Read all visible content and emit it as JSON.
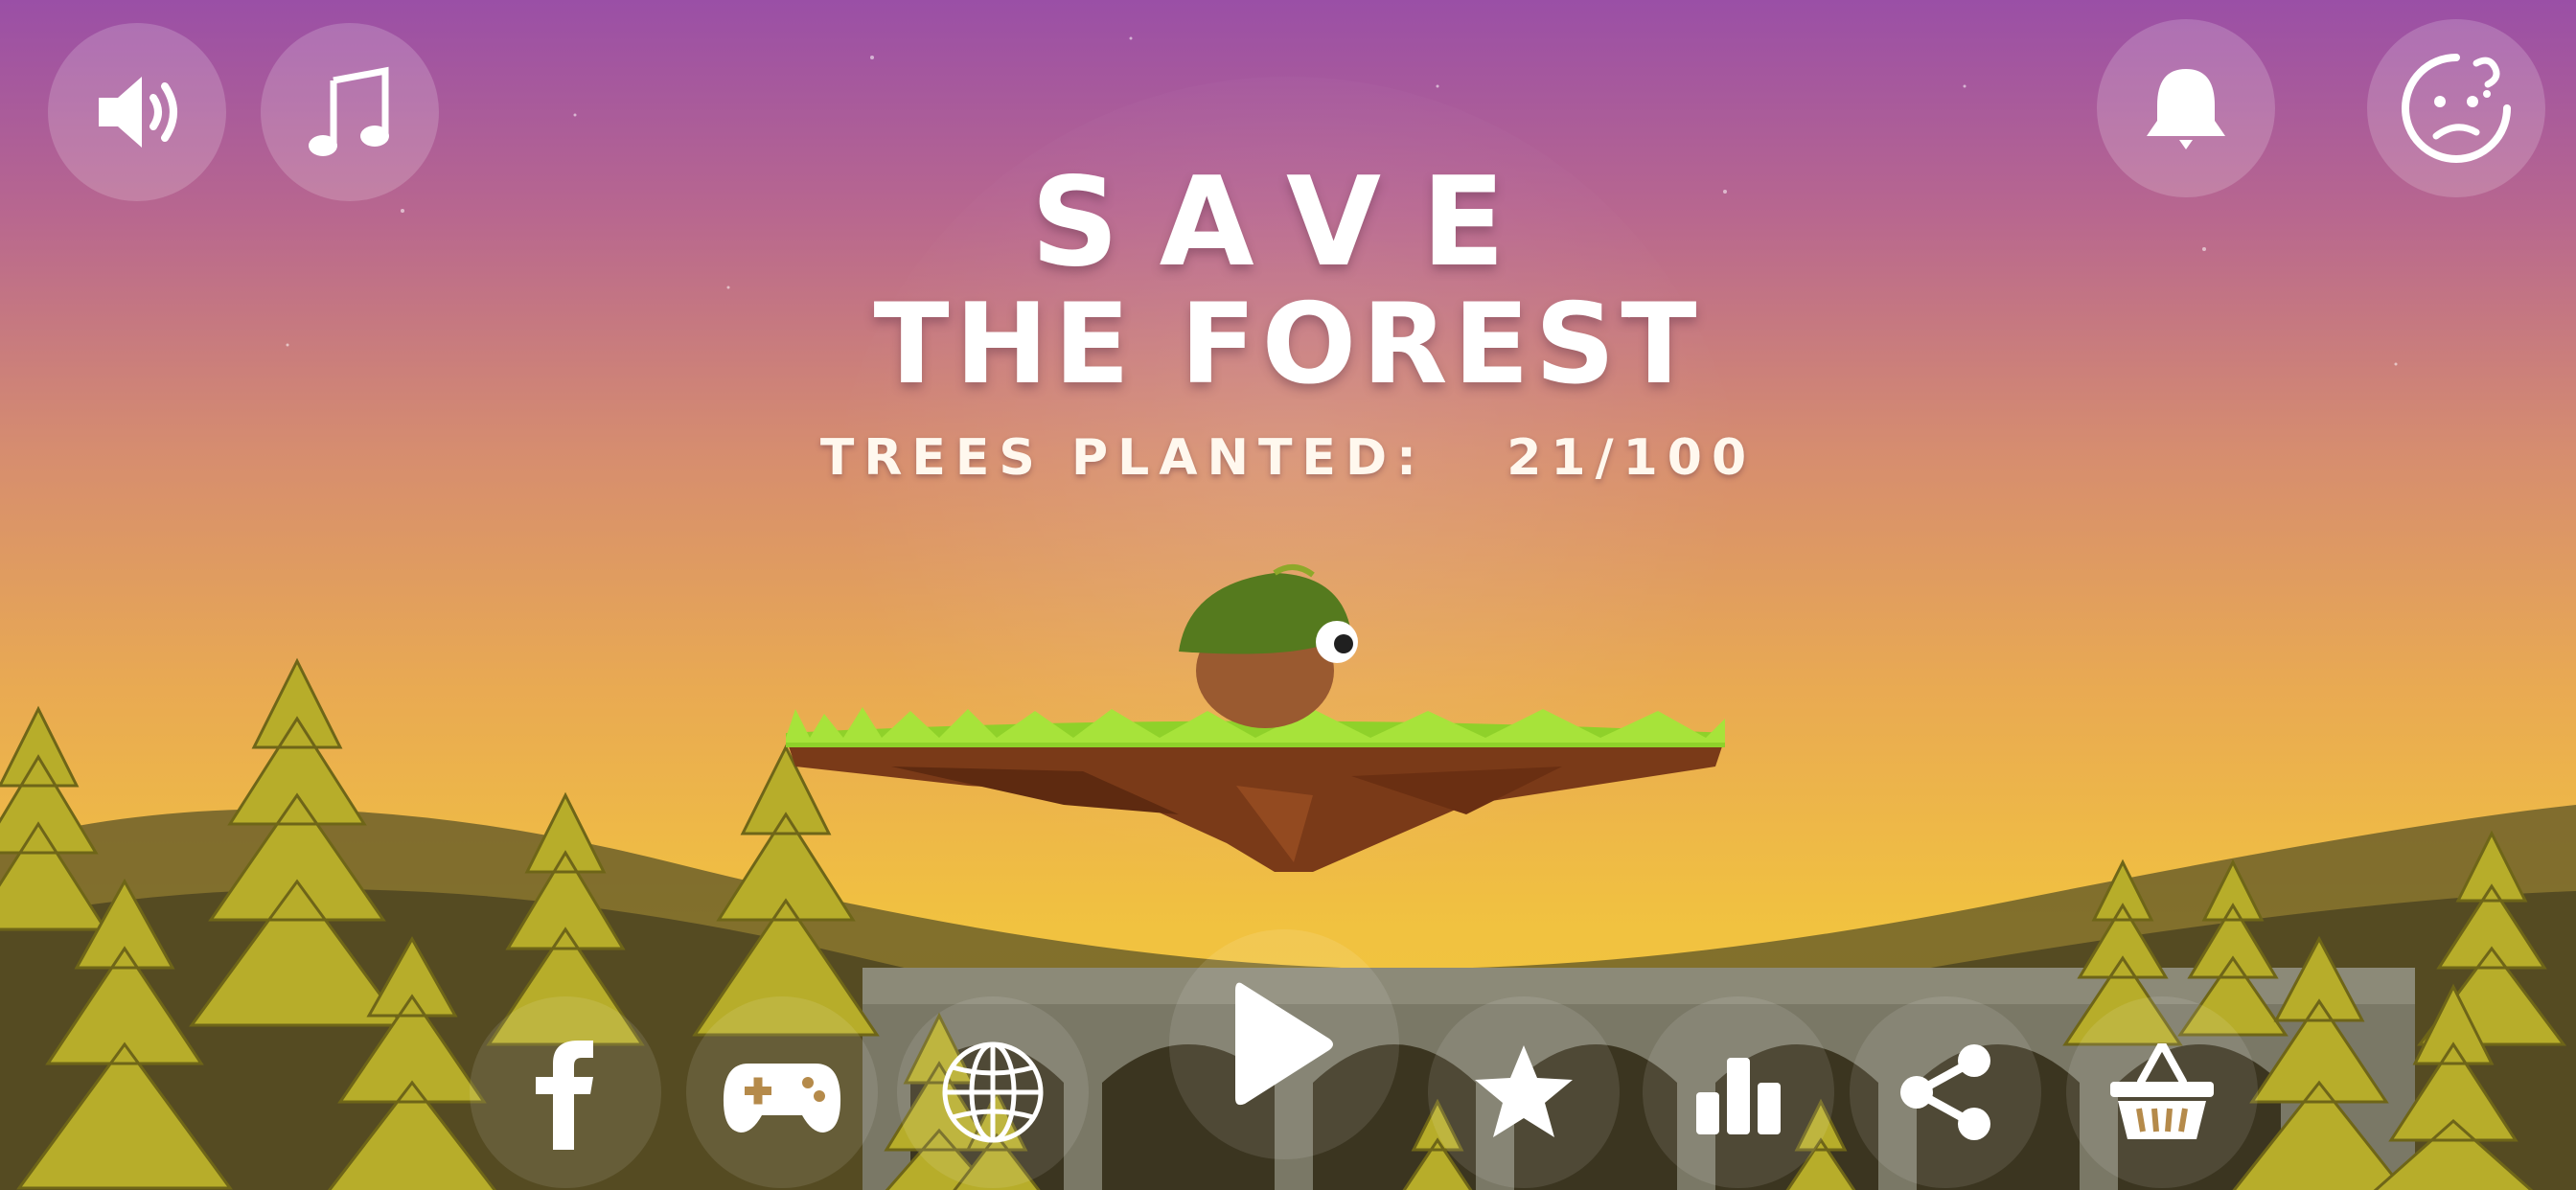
{
  "title": {
    "line1": "SAVE",
    "line2": "THE FOREST"
  },
  "progress": {
    "label": "TREES PLANTED:",
    "planted": 21,
    "goal": 100,
    "text": "21/100"
  },
  "top_left_buttons": [
    {
      "icon": "speaker-icon"
    },
    {
      "icon": "music-note-icon"
    }
  ],
  "top_right_buttons": [
    {
      "icon": "bell-icon"
    },
    {
      "icon": "confused-face-icon"
    }
  ],
  "bottom_buttons": [
    {
      "icon": "facebook-icon"
    },
    {
      "icon": "gamepad-icon"
    },
    {
      "icon": "globe-icon"
    },
    {
      "icon": "play-icon"
    },
    {
      "icon": "star-icon"
    },
    {
      "icon": "leaderboard-icon"
    },
    {
      "icon": "share-icon"
    },
    {
      "icon": "shop-basket-icon"
    }
  ],
  "colors": {
    "sky_top": "#9a4fa6",
    "sky_bottom": "#f2c83a",
    "grass": "#8fd12a",
    "dirt": "#7a3a18",
    "tree": "#b8b02a",
    "bridge": "#8c8a78"
  }
}
